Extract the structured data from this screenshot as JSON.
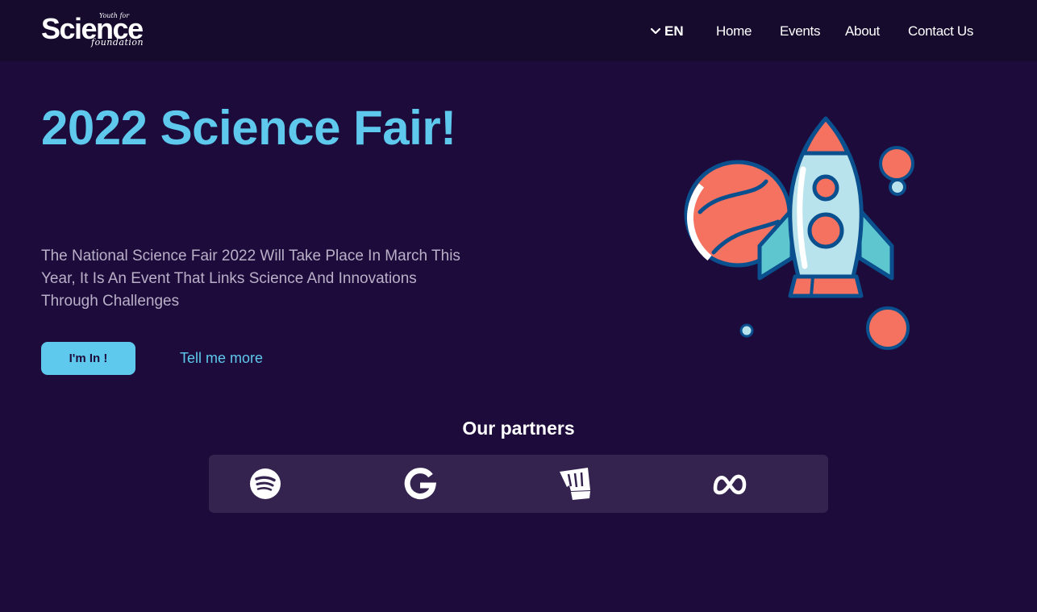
{
  "header": {
    "logo": {
      "main": "Science",
      "small_top": "Youth for",
      "small_bottom": "foundation"
    },
    "language": {
      "selected": "EN",
      "icon": "chevron-down-icon"
    },
    "nav": [
      "Home",
      "Events",
      "About",
      "Contact Us"
    ]
  },
  "hero": {
    "title": "2022 Science Fair!",
    "description": "The National Science Fair 2022 Will Take Place In March This Year, It Is An Event That Links Science And Innovations Through Challenges",
    "primary_button": "I'm In !",
    "secondary_link": "Tell me more",
    "illustration": "rocket-illustration"
  },
  "partners": {
    "title": "Our partners",
    "logos": [
      "spotify-icon",
      "google-icon",
      "riot-games-icon",
      "meta-icon"
    ]
  },
  "colors": {
    "background": "#1c0b3b",
    "topbar": "#160a2d",
    "accent": "#5ec9ec",
    "partners_box": "#34224f",
    "coral": "#f4725f",
    "light_blue": "#b8e3ec",
    "navy": "#0a4f8e"
  }
}
